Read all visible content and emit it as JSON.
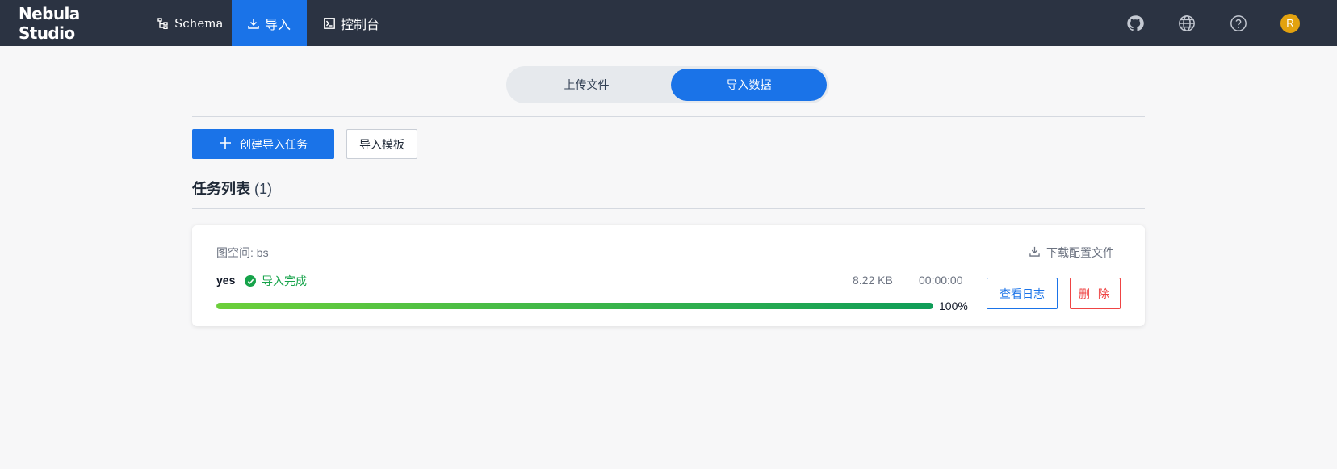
{
  "app": {
    "title": "Nebula Studio"
  },
  "nav": {
    "items": [
      {
        "label": "Schema",
        "icon": "schema-icon",
        "active": false
      },
      {
        "label": "导入",
        "icon": "import-icon",
        "active": true
      },
      {
        "label": "控制台",
        "icon": "console-icon",
        "active": false
      }
    ]
  },
  "header_right": {
    "icons": [
      "github-icon",
      "globe-icon",
      "help-icon"
    ],
    "avatar_letter": "R",
    "avatar_color": "#e3a20f"
  },
  "tabs": [
    {
      "label": "上传文件",
      "active": false
    },
    {
      "label": "导入数据",
      "active": true
    }
  ],
  "actions": {
    "create_label": "创建导入任务",
    "template_label": "导入模板"
  },
  "task_list": {
    "title": "任务列表",
    "count": "(1)"
  },
  "task": {
    "space_label": "图空间: bs",
    "download_label": "下载配置文件",
    "name": "yes",
    "status": "导入完成",
    "status_color": "#16a34a",
    "file_size": "8.22 KB",
    "elapsed": "00:00:00",
    "progress_percent": 100,
    "progress_label": "100%",
    "log_button": "查看日志",
    "delete_button": "删 除"
  },
  "colors": {
    "header_bg": "#2b3342",
    "accent": "#1a73e8",
    "danger": "#ef4444"
  }
}
